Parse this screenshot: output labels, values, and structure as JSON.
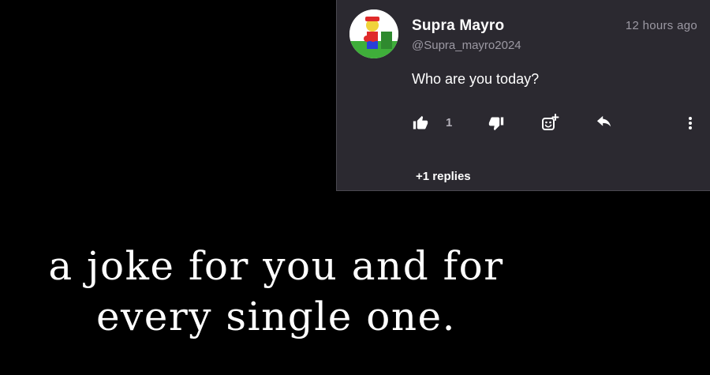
{
  "comment": {
    "username": "Supra Mayro",
    "handle": "@Supra_mayro2024",
    "timestamp": "12 hours ago",
    "text": "Who are you today?",
    "like_count": "1",
    "replies_label": "+1 replies",
    "icons": [
      "avatar",
      "thumbs-up-icon",
      "thumbs-down-icon",
      "add-reaction-icon",
      "reply-icon",
      "more-icon"
    ]
  },
  "caption": {
    "line1": "a joke for you and for",
    "line2": "every single one."
  },
  "colors": {
    "card_bg": "#2b2930",
    "page_bg": "#000000",
    "muted_text": "#9c99a3"
  }
}
